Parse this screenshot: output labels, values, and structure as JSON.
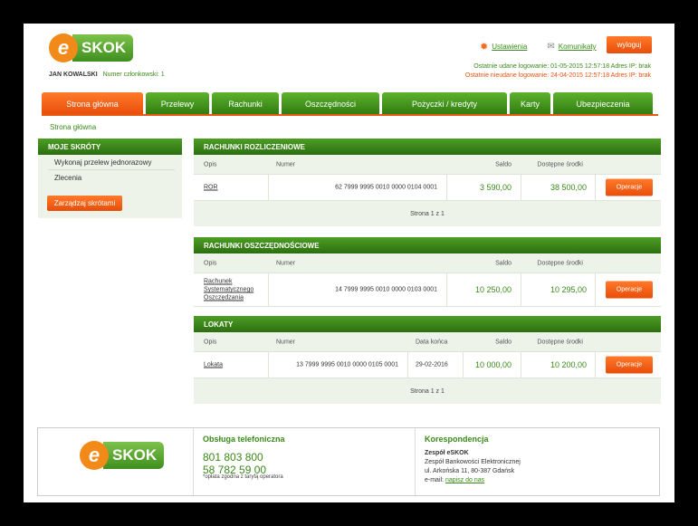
{
  "brand": {
    "logo_e": "e",
    "logo_text": "SKOK"
  },
  "user": {
    "name": "JAN KOWALSKI",
    "member_label": "Numer członkowski: 1"
  },
  "toplinks": {
    "settings": "Ustawienia",
    "messages": "Komunikaty",
    "logout": "wyloguj"
  },
  "logins": {
    "last_success": "Ostatnie udane logowanie: 01-05-2015 12:57:18 Adres IP: brak",
    "last_failed": "Ostatnie nieudane logowanie: 24-04-2015 12:57:18 Adres IP: brak"
  },
  "nav": {
    "tabs": [
      {
        "label": "Strona główna"
      },
      {
        "label": "Przelewy"
      },
      {
        "label": "Rachunki"
      },
      {
        "label": "Oszczędności"
      },
      {
        "label": "Pożyczki / kredyty"
      },
      {
        "label": "Karty"
      },
      {
        "label": "Ubezpieczenia"
      }
    ]
  },
  "breadcrumb": "Strona główna",
  "sidebar": {
    "title": "MOJE SKRÓTY",
    "items": [
      {
        "label": "Wykonaj przelew jednorazowy"
      },
      {
        "label": "Zlecenia"
      }
    ],
    "manage_button": "Zarządzaj skrótami"
  },
  "settlement": {
    "title": "RACHUNKI ROZLICZENIOWE",
    "cols": {
      "desc": "Opis",
      "number": "Numer",
      "balance": "Saldo",
      "available": "Dostępne środki"
    },
    "rows": [
      {
        "desc": "ROR",
        "number": "62 7999 9995 0010 0000 0104 0001",
        "balance": "3 590,00",
        "available": "38 500,00",
        "action": "Operacje"
      }
    ],
    "pager": "Strona 1 z 1"
  },
  "savings": {
    "title": "RACHUNKI OSZCZĘDNOŚCIOWE",
    "cols": {
      "desc": "Opis",
      "number": "Numer",
      "balance": "Saldo",
      "available": "Dostępne środki"
    },
    "rows": [
      {
        "desc": "Rachunek Systematycznego Oszczędzania",
        "number": "14 7999 9995 0010 0000 0103 0001",
        "balance": "10 250,00",
        "available": "10 295,00",
        "action": "Operacje"
      }
    ]
  },
  "deposits": {
    "title": "LOKATY",
    "cols": {
      "desc": "Opis",
      "number": "Numer",
      "end_date": "Data końca",
      "balance": "Saldo",
      "available": "Dostępne środki"
    },
    "rows": [
      {
        "desc": "Lokata",
        "number": "13 7999 9995 0010 0000 0105 0001",
        "end_date": "29-02-2016",
        "balance": "10 000,00",
        "available": "10 200,00",
        "action": "Operacje"
      }
    ],
    "pager": "Strona 1 z 1"
  },
  "footer": {
    "phone_title": "Obsługa telefoniczna",
    "phone1": "801 803 800",
    "phone2": "58 782 59 00",
    "phone_note": "*opłata zgodna z taryfą operatora",
    "mail_title": "Korespondencja",
    "org": "Zespół eSKOK",
    "dept": "Zespół Bankowości Elektronicznej",
    "street": "ul. Arkońska 11, 80-387 Gdańsk",
    "email_label": "e-mail:",
    "email_link": "napisz do nas"
  },
  "icons": {
    "settings": "gear-icon",
    "messages": "envelope-icon"
  },
  "colors": {
    "green": "#3a8a1a",
    "orange": "#e84d0a"
  }
}
